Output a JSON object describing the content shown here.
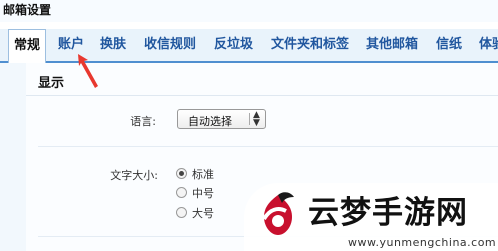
{
  "window": {
    "title": "邮箱设置"
  },
  "tabs": [
    {
      "label": "常规",
      "active": true
    },
    {
      "label": "账户"
    },
    {
      "label": "换肤"
    },
    {
      "label": "收信规则"
    },
    {
      "label": "反垃圾"
    },
    {
      "label": "文件夹和标签"
    },
    {
      "label": "其他邮箱"
    },
    {
      "label": "信纸"
    },
    {
      "label": "体验"
    }
  ],
  "section": {
    "title": "显示"
  },
  "language": {
    "label": "语言:",
    "selected": "自动选择"
  },
  "font_size": {
    "label": "文字大小:",
    "options": [
      {
        "label": "标准",
        "checked": true
      },
      {
        "label": "中号"
      },
      {
        "label": "大号"
      }
    ]
  },
  "watermark": {
    "text": "云梦手游网",
    "url": "www.yunmengchina.com"
  },
  "colors": {
    "tab_bar": "#e9f3fb",
    "tab_text": "#21579f",
    "arrow": "#e8382f"
  }
}
